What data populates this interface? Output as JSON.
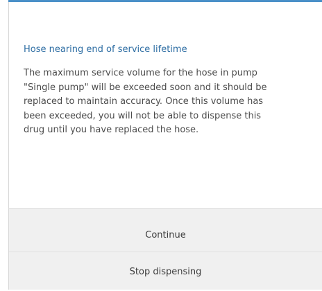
{
  "dialog": {
    "title": "Hose nearing end of service lifetime",
    "message": "The maximum service volume for the hose in pump\n\"Single pump\" will be exceeded soon and it should be\nreplaced to maintain accuracy.  Once this volume has\nbeen exceeded, you will not be able to dispense this\ndrug until you have replaced the hose.",
    "continue_label": "Continue",
    "stop_label": "Stop dispensing"
  },
  "colors": {
    "accent": "#4a90c8",
    "title": "#2d6da3",
    "text": "#4b4b4b",
    "button_bg": "#f0f0f0"
  }
}
